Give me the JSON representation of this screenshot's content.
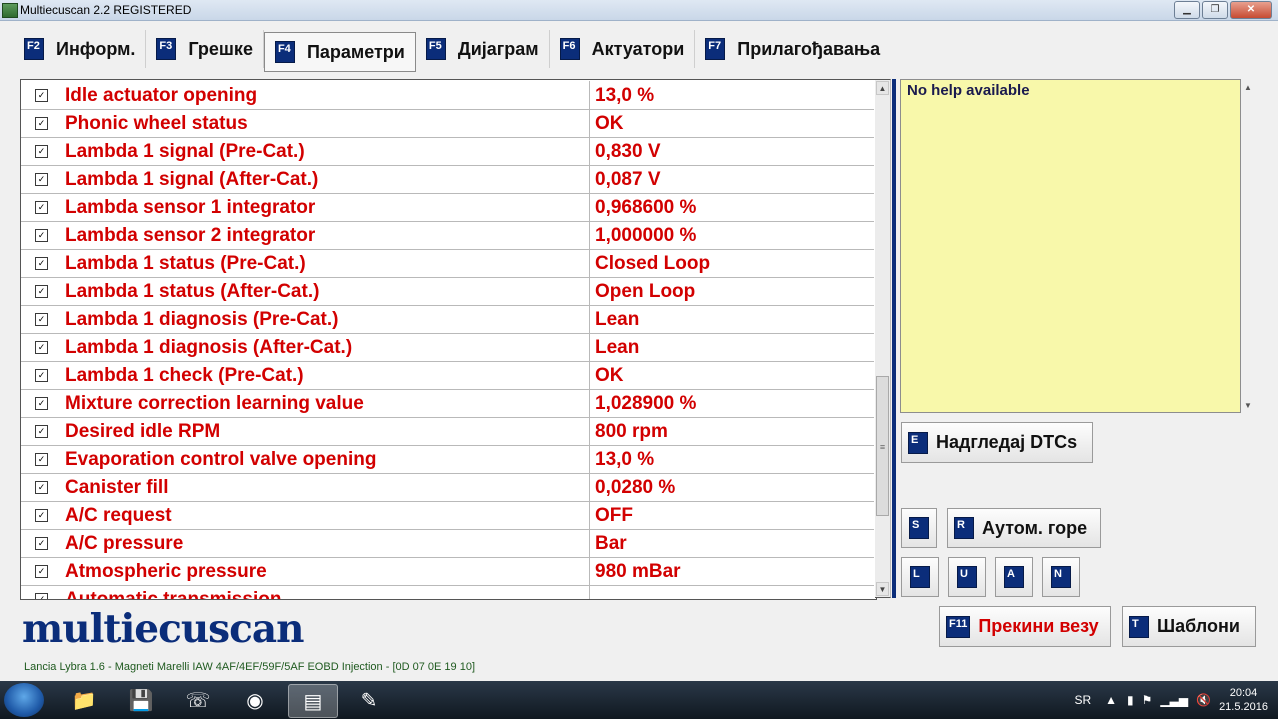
{
  "window": {
    "title": "Multiecuscan 2.2 REGISTERED"
  },
  "tabs": [
    {
      "key": "F2",
      "label": "Информ."
    },
    {
      "key": "F3",
      "label": "Грешке"
    },
    {
      "key": "F4",
      "label": "Параметри",
      "active": true
    },
    {
      "key": "F5",
      "label": "Дијаграм"
    },
    {
      "key": "F6",
      "label": "Актуатори"
    },
    {
      "key": "F7",
      "label": "Прилагођавања"
    }
  ],
  "params": [
    {
      "name": "Idle actuator opening",
      "value": "13,0 %"
    },
    {
      "name": "Phonic wheel status",
      "value": "OK"
    },
    {
      "name": "Lambda 1 signal (Pre-Cat.)",
      "value": "0,830 V"
    },
    {
      "name": "Lambda 1 signal (After-Cat.)",
      "value": "0,087 V"
    },
    {
      "name": "Lambda sensor 1 integrator",
      "value": "0,968600 %"
    },
    {
      "name": "Lambda sensor 2 integrator",
      "value": "1,000000 %"
    },
    {
      "name": "Lambda 1 status (Pre-Cat.)",
      "value": "Closed Loop"
    },
    {
      "name": "Lambda 1 status (After-Cat.)",
      "value": "Open Loop"
    },
    {
      "name": "Lambda 1 diagnosis (Pre-Cat.)",
      "value": "Lean"
    },
    {
      "name": "Lambda 1 diagnosis (After-Cat.)",
      "value": "Lean"
    },
    {
      "name": "Lambda 1 check (Pre-Cat.)",
      "value": "OK"
    },
    {
      "name": "Mixture correction learning value",
      "value": "1,028900 %"
    },
    {
      "name": "Desired idle RPM",
      "value": "800 rpm"
    },
    {
      "name": "Evaporation control valve opening",
      "value": "13,0 %"
    },
    {
      "name": "Canister fill",
      "value": "0,0280 %"
    },
    {
      "name": "A/C request",
      "value": "OFF"
    },
    {
      "name": "A/C pressure",
      "value": " Bar"
    },
    {
      "name": "Atmospheric pressure",
      "value": "980 mBar"
    },
    {
      "name": "Automatic transmission",
      "value": ""
    }
  ],
  "help": {
    "text": "No help available"
  },
  "buttons": {
    "monitor_dtc": {
      "key": "E",
      "label": "Надгледај DTCs"
    },
    "s": {
      "key": "S"
    },
    "auto_up": {
      "key": "R",
      "label": "Аутом. горе"
    },
    "l": {
      "key": "L"
    },
    "u": {
      "key": "U"
    },
    "a": {
      "key": "A"
    },
    "n": {
      "key": "N"
    },
    "disconnect": {
      "key": "F11",
      "label": "Прекини везу"
    },
    "templates": {
      "key": "T",
      "label": "Шаблони"
    }
  },
  "logo": {
    "text": "multiecuscan"
  },
  "status": {
    "text": "Lancia Lybra 1.6 - Magneti Marelli IAW 4AF/4EF/59F/5AF EOBD Injection - [0D 07 0E 19 10]"
  },
  "taskbar": {
    "lang": "SR",
    "time": "20:04",
    "date": "21.5.2016"
  },
  "colors": {
    "param_text": "#d20000",
    "fkey_bg": "#0b2d7a",
    "help_bg": "#f8f8aa"
  }
}
